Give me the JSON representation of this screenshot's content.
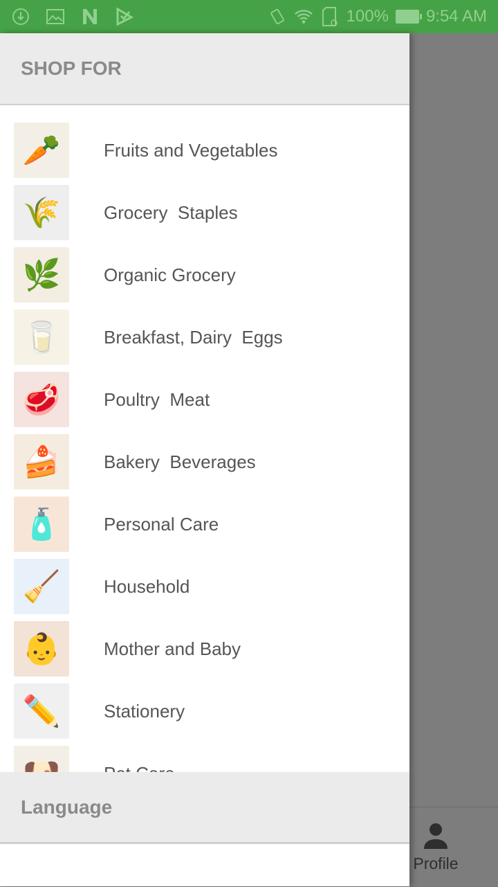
{
  "status_bar": {
    "battery_percent": "100%",
    "time": "9:54 AM",
    "colors": {
      "background": "#46a246",
      "foreground": "#8fd08f"
    }
  },
  "drawer": {
    "header": "SHOP FOR",
    "items": [
      {
        "label": "Fruits and Vegetables",
        "icon": "fruits-vegetables-image",
        "glyph": "🥕",
        "bg": "#f4efe6"
      },
      {
        "label": "Grocery  Staples",
        "icon": "grocery-staples-image",
        "glyph": "🌾",
        "bg": "#eeeeee"
      },
      {
        "label": "Organic Grocery",
        "icon": "organic-grocery-image",
        "glyph": "🌿",
        "bg": "#f3ede2"
      },
      {
        "label": "Breakfast, Dairy  Eggs",
        "icon": "breakfast-dairy-eggs-image",
        "glyph": "🥛",
        "bg": "#f6f3e6"
      },
      {
        "label": "Poultry  Meat",
        "icon": "poultry-meat-image",
        "glyph": "🥩",
        "bg": "#f5e3e0"
      },
      {
        "label": "Bakery  Beverages",
        "icon": "bakery-beverages-image",
        "glyph": "🍰",
        "bg": "#f5ece0"
      },
      {
        "label": "Personal Care",
        "icon": "personal-care-image",
        "glyph": "🧴",
        "bg": "#f7e6d8"
      },
      {
        "label": "Household",
        "icon": "household-image",
        "glyph": "🧹",
        "bg": "#e8f0fa"
      },
      {
        "label": "Mother and Baby",
        "icon": "mother-baby-image",
        "glyph": "👶",
        "bg": "#f3e2d6"
      },
      {
        "label": "Stationery",
        "icon": "stationery-image",
        "glyph": "✏️",
        "bg": "#f0f0f0"
      },
      {
        "label": "Pet Care",
        "icon": "pet-care-image",
        "glyph": "🐶",
        "bg": "#f4efe6"
      }
    ],
    "language_section": "Language"
  },
  "bottom_nav": {
    "profile_label": "Profile"
  }
}
